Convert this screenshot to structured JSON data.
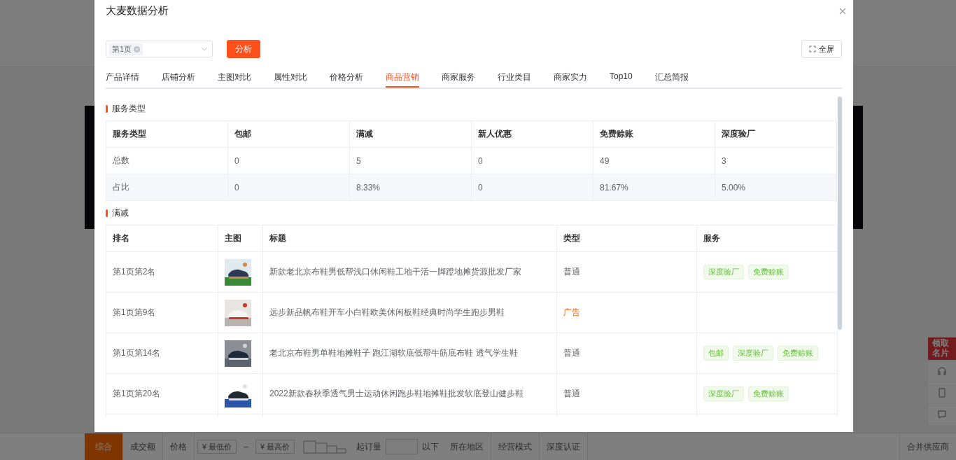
{
  "background": {
    "side_badge": "领取名片",
    "filter_bar": [
      {
        "kind": "active",
        "text": "综合"
      },
      {
        "kind": "sort",
        "text": "成交额"
      },
      {
        "kind": "sort",
        "text": "价格"
      },
      {
        "kind": "input",
        "text": "¥ 最低价"
      },
      {
        "kind": "plain",
        "text": "–"
      },
      {
        "kind": "input",
        "text": "¥ 最高价"
      },
      {
        "kind": "plain",
        "text": "起订量"
      },
      {
        "kind": "blank"
      },
      {
        "kind": "plain",
        "text": "以下"
      },
      {
        "kind": "drop",
        "text": "所在地区"
      },
      {
        "kind": "drop",
        "text": "经营模式"
      },
      {
        "kind": "drop",
        "text": "深度认证"
      }
    ],
    "merge_label": "合并供应商"
  },
  "dialog": {
    "title": "大麦数据分析",
    "select_tag": "第1页",
    "analyze_button": "分析",
    "fullscreen_button": "全屏",
    "tabs": [
      {
        "label": "产品详情",
        "selected": false
      },
      {
        "label": "店铺分析",
        "selected": false
      },
      {
        "label": "主图对比",
        "selected": false
      },
      {
        "label": "属性对比",
        "selected": false
      },
      {
        "label": "价格分析",
        "selected": false
      },
      {
        "label": "商品营销",
        "selected": true
      },
      {
        "label": "商家服务",
        "selected": false
      },
      {
        "label": "行业类目",
        "selected": false
      },
      {
        "label": "商家实力",
        "selected": false
      },
      {
        "label": "Top10",
        "selected": false
      },
      {
        "label": "汇总简报",
        "selected": false
      }
    ],
    "service_section": {
      "title": "服务类型",
      "columns": [
        "服务类型",
        "包邮",
        "满减",
        "新人优惠",
        "免费赊账",
        "深度验厂"
      ],
      "rows": [
        [
          "总数",
          "0",
          "5",
          "0",
          "49",
          "3"
        ],
        [
          "占比",
          "0",
          "8.33%",
          "0",
          "81.67%",
          "5.00%"
        ]
      ]
    },
    "discount_section": {
      "title": "满减",
      "columns": [
        "排名",
        "主图",
        "标题",
        "类型",
        "服务"
      ],
      "rows": [
        {
          "rank": "第1页第2名",
          "title": "新款老北京布鞋男低帮浅口休闲鞋工地干活一脚蹬地摊货源批发厂家",
          "type": "普通",
          "ad": false,
          "services": [
            "深度验厂",
            "免费赊账"
          ]
        },
        {
          "rank": "第1页第9名",
          "title": "远步新品帆布鞋开车小白鞋欧美休闲板鞋经典时尚学生跑步男鞋",
          "type": "广告",
          "ad": true,
          "services": []
        },
        {
          "rank": "第1页第14名",
          "title": "老北京布鞋男单鞋地摊鞋子 跑江湖软底低帮牛筋底布鞋 透气学生鞋",
          "type": "普通",
          "ad": false,
          "services": [
            "包邮",
            "深度验厂",
            "免费赊账"
          ]
        },
        {
          "rank": "第1页第20名",
          "title": "2022新款春秋季透气男士运动休闲跑步鞋地摊鞋批发软底登山健步鞋",
          "type": "普通",
          "ad": false,
          "services": [
            "深度验厂",
            "免费赊账"
          ]
        }
      ]
    }
  }
}
